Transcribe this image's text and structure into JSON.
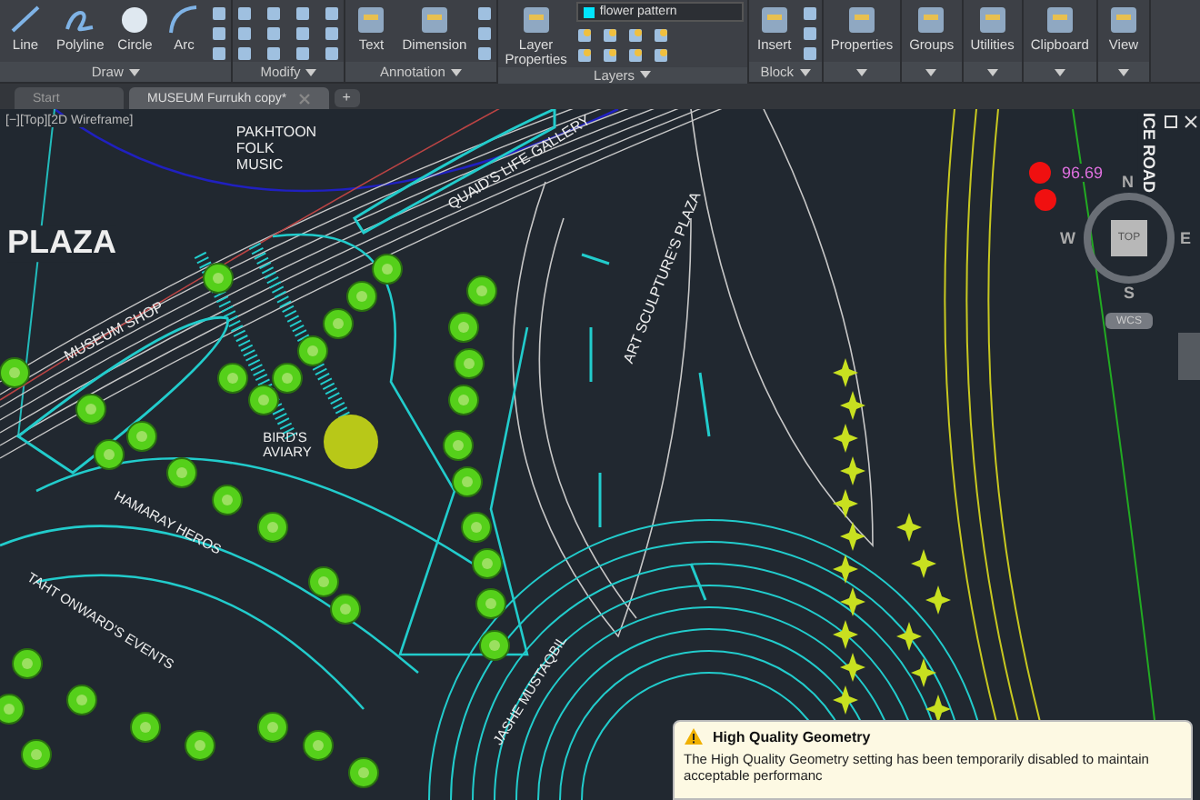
{
  "ribbon": {
    "panels": [
      {
        "title": "Draw",
        "tools": [
          {
            "label": "Line"
          },
          {
            "label": "Polyline"
          },
          {
            "label": "Circle"
          },
          {
            "label": "Arc"
          }
        ]
      },
      {
        "title": "Modify"
      },
      {
        "title": "Annotation",
        "tools": [
          {
            "label": "Text"
          },
          {
            "label": "Dimension"
          }
        ]
      },
      {
        "title": "Layers",
        "tools": [
          {
            "label": "Layer\nProperties"
          }
        ],
        "layer_dropdown": {
          "value": "flower pattern",
          "color": "#00e5ff"
        }
      },
      {
        "title": "Block",
        "tools": [
          {
            "label": "Insert"
          }
        ]
      },
      {
        "tools": [
          {
            "label": "Properties"
          }
        ]
      },
      {
        "tools": [
          {
            "label": "Groups"
          }
        ]
      },
      {
        "tools": [
          {
            "label": "Utilities"
          }
        ]
      },
      {
        "tools": [
          {
            "label": "Clipboard"
          }
        ]
      },
      {
        "tools": [
          {
            "label": "View"
          }
        ]
      }
    ]
  },
  "file_tabs": [
    {
      "label": "Start",
      "selected": false,
      "closable": false
    },
    {
      "label": "MUSEUM Furrukh copy*",
      "selected": true,
      "closable": true
    }
  ],
  "new_tab": "+",
  "viewport": {
    "view_controls": "[−][Top][2D Wireframe]",
    "labels": [
      "PAKHTOON\nFOLK\nMUSIC",
      "PLAZA",
      "QUAID'S LIFE GALLERY",
      "MUSEUM SHOP",
      "ART SCULPTURE'S PLAZA",
      "BIRD'S\nAVIARY",
      "HAMARAY HEROS",
      "TAHT ONWARD'S EVENTS",
      "JASHE MUSTAQBIL",
      "ICE ROAD"
    ],
    "coordinate": "96.69",
    "compass": {
      "north": "N",
      "west": "W",
      "east": "E",
      "south": "S",
      "top": "TOP",
      "ucs": "WCS"
    }
  },
  "notification": {
    "title": "High Quality Geometry",
    "message": "The High Quality Geometry setting has been temporarily disabled to maintain acceptable performanc"
  }
}
